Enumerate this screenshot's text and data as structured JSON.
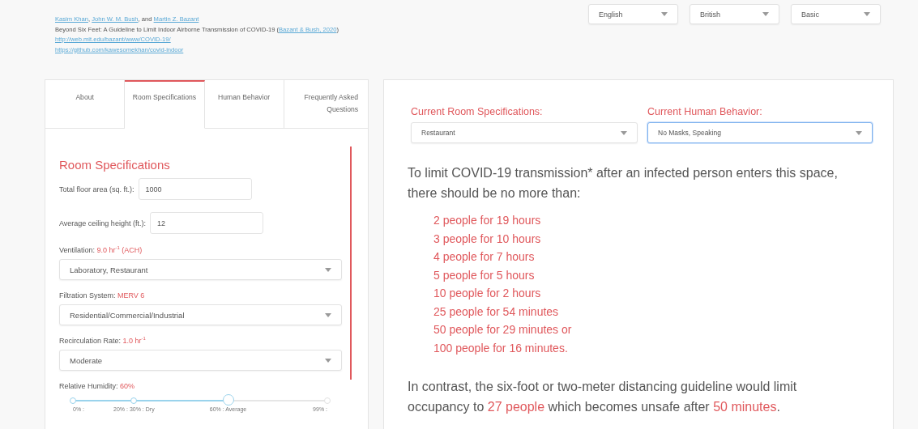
{
  "citation": {
    "authors": [
      {
        "text": "Kasim Khan",
        "link": true
      },
      {
        "text": ", ",
        "link": false
      },
      {
        "text": "John W. M. Bush",
        "link": true
      },
      {
        "text": ", and ",
        "link": false
      },
      {
        "text": "Martin Z. Bazant",
        "link": true
      }
    ],
    "title": [
      {
        "text": "Beyond Six Feet: A Guideline to Limit Indoor Airborne Transmission of COVID-19 (",
        "link": false
      },
      {
        "text": "Bazant & Bush, 2020",
        "link": true
      },
      {
        "text": ")",
        "link": false
      }
    ],
    "links": [
      "http://web.mit.edu/bazant/www/COVID-19/",
      "https://github.com/kawesomekhan/covid-indoor"
    ]
  },
  "settings": [
    "English",
    "British",
    "Basic"
  ],
  "tabs": [
    {
      "label": "About",
      "selected": false
    },
    {
      "label": "Room Specifications",
      "selected": true
    },
    {
      "label": "Human Behavior",
      "selected": false
    },
    {
      "label": "Frequently Asked Questions",
      "selected": false
    }
  ],
  "room": {
    "heading": "Room Specifications",
    "fields": [
      {
        "kind": "input",
        "label": "Total floor area (sq. ft.):",
        "value": "1000"
      },
      {
        "kind": "input",
        "label": "Average ceiling height (ft.):",
        "value": "12"
      },
      {
        "kind": "select",
        "label": "Ventilation:",
        "reading": "9.0 hr$^{-1}$ (ACH)",
        "value": "Laboratory, Restaurant"
      },
      {
        "kind": "select",
        "label": "Filtration System:",
        "reading": "MERV 6",
        "value": "Residential/Commercial/Industrial"
      },
      {
        "kind": "select",
        "label": "Recirculation Rate:",
        "reading": "1.0 hr$^{-1}$",
        "value": "Moderate"
      },
      {
        "kind": "slider",
        "label": "Relative Humidity:",
        "reading": "60%",
        "level": 0.61,
        "ticks": [
          {
            "label": "0% :"
          },
          {
            "label": "20% : 30% : Dry"
          },
          {
            "label": "60% : Average"
          },
          {
            "label": "99% :"
          }
        ]
      }
    ]
  },
  "current": [
    {
      "label": "Current Room Specifications:",
      "value": "Restaurant",
      "focused": false
    },
    {
      "label": "Current Human Behavior:",
      "value": "No Masks, Speaking",
      "focused": true
    }
  ],
  "intro": "To limit COVID-19 transmission* after an infected person enters this space, there should be no more than:",
  "limits": [
    "2 people for 19 hours",
    "3 people for 10 hours",
    "4 people for 7 hours",
    "5 people for 5 hours",
    "10 people for 2 hours",
    "25 people for 54 minutes",
    "50 people for 29 minutes or",
    "100 people for 16 minutes."
  ],
  "contrast": [
    {
      "text": "In contrast, the six-foot or two-meter distancing guideline would limit occupancy to ",
      "highlight": false
    },
    {
      "text": "27 people",
      "highlight": true
    },
    {
      "text": " which becomes unsafe after ",
      "highlight": false
    },
    {
      "text": "50 minutes",
      "highlight": true
    },
    {
      "text": ".",
      "highlight": false
    }
  ]
}
